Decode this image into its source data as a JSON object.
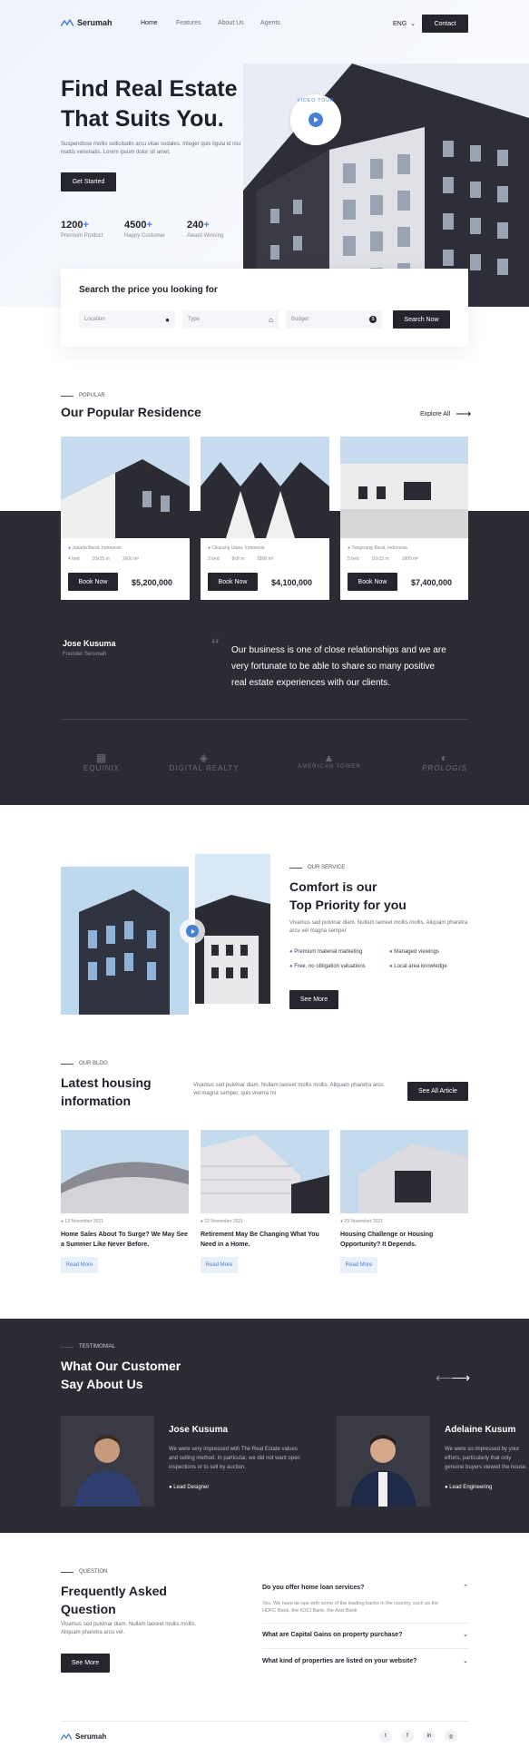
{
  "nav": {
    "brand": "Serumah",
    "links": [
      "Home",
      "Features",
      "About Us",
      "Agents"
    ],
    "lang": "ENG",
    "contact": "Contact"
  },
  "hero": {
    "title_line1": "Find Real Estate",
    "title_line2": "That Suits You.",
    "desc": "Suspendisse mollis sollicitudin arcu vitae sodales. Integer quis ligula id nisi mattis venenatis. Lorem ipsum dolor sit amet.",
    "cta": "Get Started",
    "badge": "VIDEO TOUR",
    "stats": [
      {
        "value": "1200",
        "label": "Premium Product"
      },
      {
        "value": "4500",
        "label": "Happy Customer"
      },
      {
        "value": "240",
        "label": "Award Winning"
      }
    ]
  },
  "search": {
    "title": "Search the price you looking for",
    "location": "Location",
    "type": "Type",
    "budget": "Budget",
    "button": "Search Now"
  },
  "popular": {
    "eyebrow": "POPULAR",
    "title": "Our Popular Residence",
    "explore": "Explore All",
    "cards": [
      {
        "address": "Jakarta Barat, Indonesia",
        "beds": "4 bed",
        "size1": "10x15 m",
        "size2": "1600 m²",
        "cta": "Book Now",
        "price": "$5,200,000"
      },
      {
        "address": "Cikarang Utara, Indonesia",
        "beds": "3 bed",
        "size1": "8x9 m",
        "size2": "1800 m²",
        "cta": "Book Now",
        "price": "$4,100,000"
      },
      {
        "address": "Tangerang Barat, Indonesia",
        "beds": "5 bed",
        "size1": "10x15 m",
        "size2": "1600 m²",
        "cta": "Book Now",
        "price": "$7,400,000"
      }
    ]
  },
  "quote": {
    "name": "Jose Kusuma",
    "role": "Founder Serumah",
    "text_line1": "Our business is one of close relationships and we are",
    "text_line2": "very fortunate to be able to share so many positive",
    "text_line3": "real estate experiences with our clients."
  },
  "partners": [
    "EQUINIX",
    "DIGITAL REALTY",
    "AMERICAN TOWER",
    "PROLOGIS"
  ],
  "service": {
    "eyebrow": "OUR SERVICE",
    "title_line1": "Comfort is our",
    "title_line2": "Top Priority for you",
    "desc": "Vivamus sed pulvinar diam. Nullam laoreet mollis mollis. Aliquam pharetra arcu vel magna semper",
    "features": [
      "Premium material marketing",
      "Managed viewings",
      "Free, no obligation valuations",
      "Local area knowledge"
    ],
    "cta": "See More"
  },
  "blog": {
    "eyebrow": "OUR BLOG",
    "title_line1": "Latest housing",
    "title_line2": "information",
    "desc": "Vivamus sed pulvinar diam. Nullam laoreet mollis mollis. Aliquam pharetra arcu vel magna semper, quis viverra mi",
    "cta": "See All Article",
    "posts": [
      {
        "date": "13 November 2021",
        "title": "Home Sales About To Surge? We May See a Summer Like Never Before.",
        "cta": "Read More"
      },
      {
        "date": "22 November 2021",
        "title": "Retirement May Be Changing What You Need in a Home.",
        "cta": "Read More"
      },
      {
        "date": "29 November 2021",
        "title": "Housing Challenge or Housing Opportunity? It Depends.",
        "cta": "Read More"
      }
    ]
  },
  "testimonial": {
    "eyebrow": "TESTIMONIAL",
    "title_line1": "What Our Customer",
    "title_line2": "Say About Us",
    "items": [
      {
        "name": "Jose Kusuma",
        "text": "We were very impressed with The Real Estate values and selling method. In particular, we did not want open inspections or to sell by auction.",
        "role": "Lead Designer"
      },
      {
        "name": "Adelaine Kusum",
        "text": "We were so impressed by your efforts, particularly that only genuine buyers viewed the house.",
        "role": "Lead Engineering"
      }
    ]
  },
  "faq": {
    "eyebrow": "QUESTION",
    "title_line1": "Frequently Asked",
    "title_line2": "Question",
    "desc": "Vivamus sed pulvinar diam. Nullam laoreet mollis mollis. Aliquam pharetra arcu vel.",
    "cta": "See More",
    "items": [
      {
        "q": "Do you offer home loan services?",
        "a": "Yes. We have tie-ups with some of the leading banks in the country, such as the HDFC Bank, the ICICI Bank, the Axis Bank"
      },
      {
        "q": "What are Capital Gains on property purchase?",
        "a": ""
      },
      {
        "q": "What kind of properties are listed on your website?",
        "a": ""
      }
    ]
  },
  "footer": {
    "brand": "Serumah"
  }
}
